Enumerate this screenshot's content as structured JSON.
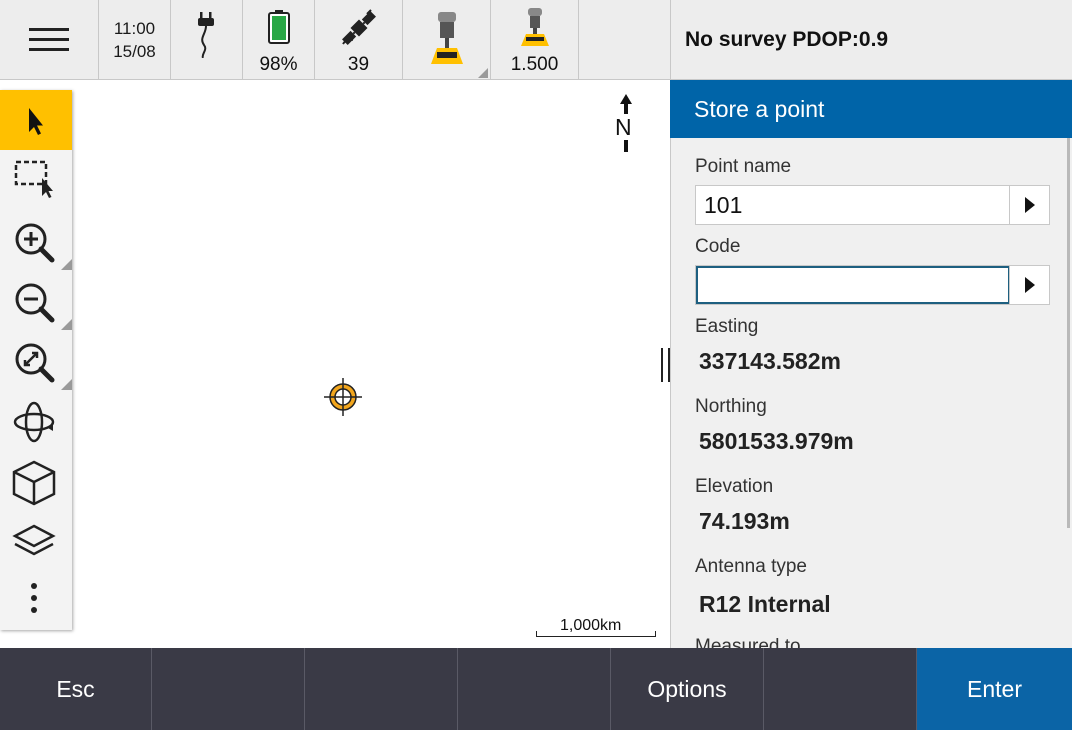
{
  "status": {
    "time": "11:00",
    "date": "15/08",
    "battery_percent": "98%",
    "satellites": "39",
    "antenna_height": "1.500",
    "survey_status": "No survey  PDOP:0.9"
  },
  "map": {
    "north_label": "N",
    "scale_label": "1,000km",
    "tools": [
      "select-icon",
      "box-select-icon",
      "zoom-in-icon",
      "zoom-out-icon",
      "zoom-extents-icon",
      "orbit-icon",
      "cube-icon",
      "layers-icon",
      "more-icon"
    ]
  },
  "panel": {
    "title": "Store a point",
    "point_name_label": "Point name",
    "point_name_value": "101",
    "code_label": "Code",
    "code_value": "",
    "easting_label": "Easting",
    "easting_value": "337143.582m",
    "northing_label": "Northing",
    "northing_value": "5801533.979m",
    "elevation_label": "Elevation",
    "elevation_value": "74.193m",
    "antenna_type_label": "Antenna type",
    "antenna_type_value": "R12 Internal",
    "measured_to_label": "Measured to"
  },
  "softkeys": {
    "esc": "Esc",
    "options": "Options",
    "enter": "Enter"
  },
  "colors": {
    "accent": "#0064a8",
    "active_tool": "#ffc000",
    "softbar": "#3a3a46",
    "enter_key": "#0b64a6"
  }
}
